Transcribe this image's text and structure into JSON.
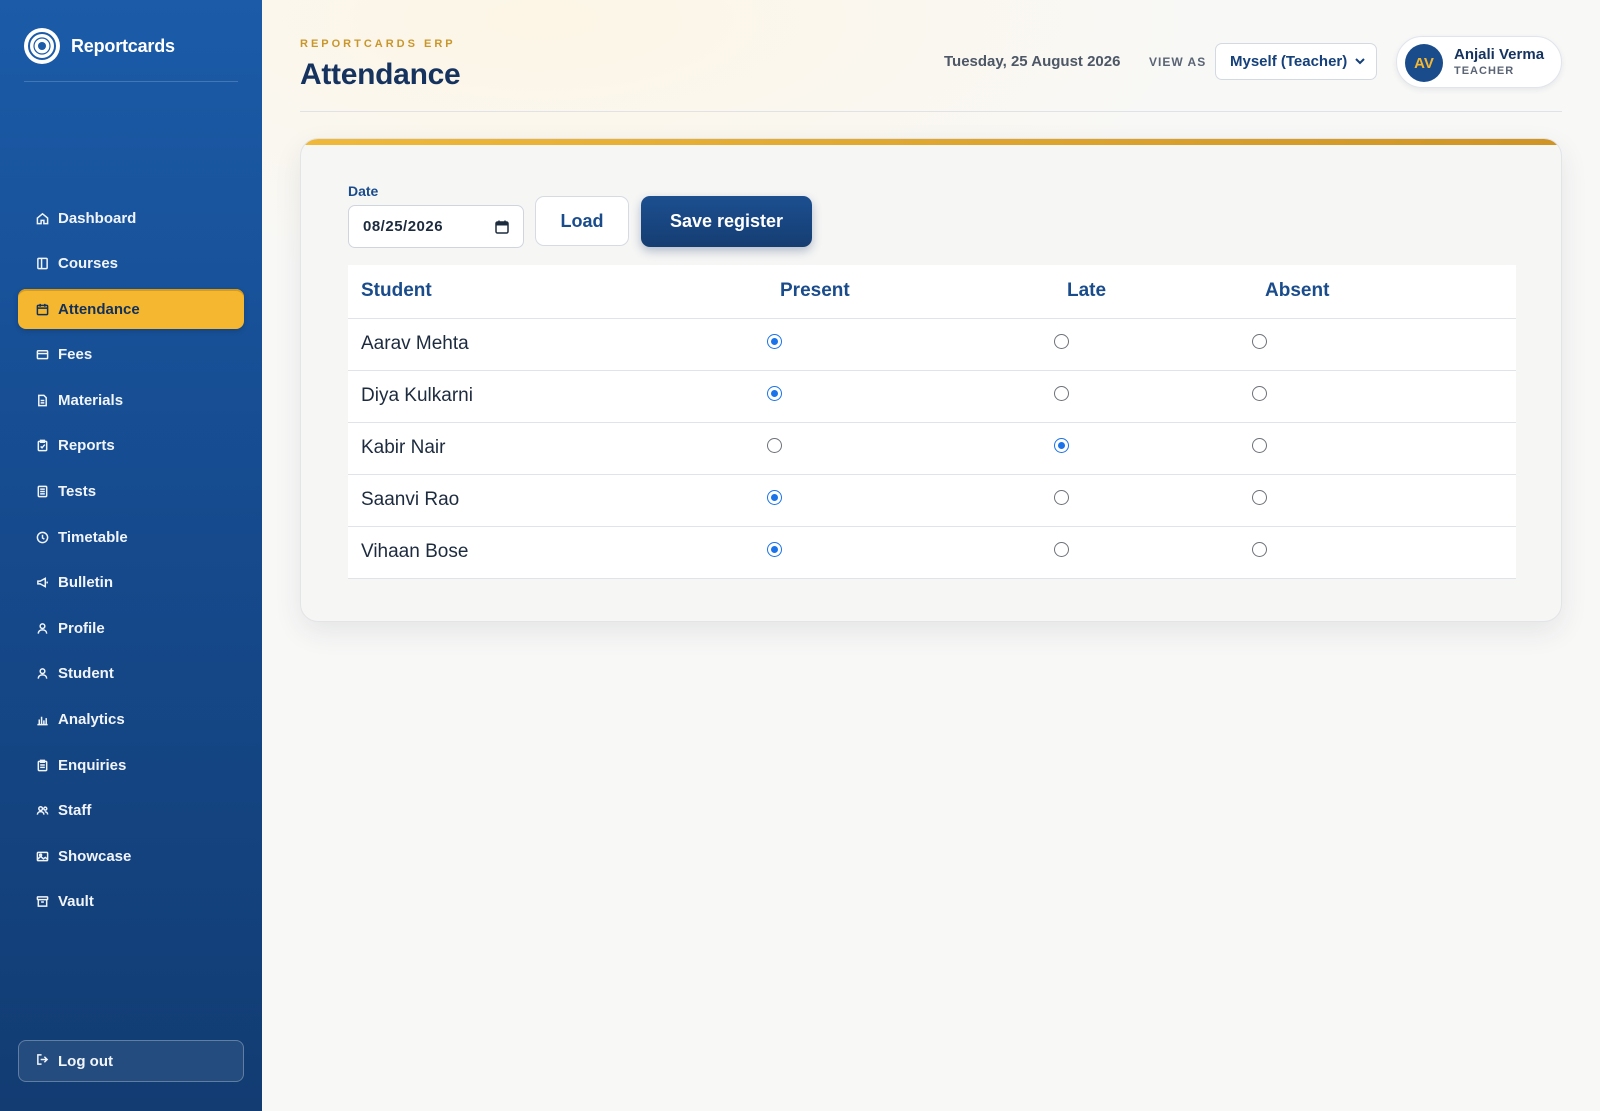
{
  "brand": {
    "name": "Reportcards"
  },
  "sidebar": {
    "items": [
      {
        "label": "Dashboard",
        "icon": "home-icon",
        "active": false
      },
      {
        "label": "Courses",
        "icon": "book-icon",
        "active": false
      },
      {
        "label": "Attendance",
        "icon": "calendar-icon",
        "active": true
      },
      {
        "label": "Fees",
        "icon": "wallet-icon",
        "active": false
      },
      {
        "label": "Materials",
        "icon": "document-icon",
        "active": false
      },
      {
        "label": "Reports",
        "icon": "clipboard-icon",
        "active": false
      },
      {
        "label": "Tests",
        "icon": "test-sheet-icon",
        "active": false
      },
      {
        "label": "Timetable",
        "icon": "clock-icon",
        "active": false
      },
      {
        "label": "Bulletin",
        "icon": "megaphone-icon",
        "active": false
      },
      {
        "label": "Profile",
        "icon": "user-icon",
        "active": false
      },
      {
        "label": "Student",
        "icon": "user-icon",
        "active": false
      },
      {
        "label": "Analytics",
        "icon": "bar-chart-icon",
        "active": false
      },
      {
        "label": "Enquiries",
        "icon": "clipboard-list-icon",
        "active": false
      },
      {
        "label": "Staff",
        "icon": "users-icon",
        "active": false
      },
      {
        "label": "Showcase",
        "icon": "image-icon",
        "active": false
      },
      {
        "label": "Vault",
        "icon": "archive-icon",
        "active": false
      }
    ],
    "logout_label": "Log out"
  },
  "header": {
    "kicker": "REPORTCARDS ERP",
    "title": "Attendance",
    "date": "Tuesday, 25 August 2026",
    "view_as_label": "VIEW AS",
    "view_as_value": "Myself (Teacher)",
    "user": {
      "initials": "AV",
      "name": "Anjali Verma",
      "role": "TEACHER"
    }
  },
  "form": {
    "date_label": "Date",
    "date_value": "08/25/2026",
    "load_label": "Load",
    "save_label": "Save register"
  },
  "table": {
    "columns": [
      "Student",
      "Present",
      "Late",
      "Absent"
    ],
    "rows": [
      {
        "student": "Aarav Mehta",
        "status": "Present"
      },
      {
        "student": "Diya Kulkarni",
        "status": "Present"
      },
      {
        "student": "Kabir Nair",
        "status": "Late"
      },
      {
        "student": "Saanvi Rao",
        "status": "Present"
      },
      {
        "student": "Vihaan Bose",
        "status": "Present"
      }
    ]
  },
  "colors": {
    "sidebar": "#1b5ba8",
    "accent": "#f5b730",
    "primary": "#153d72",
    "radio_selected": "#1a73e8"
  }
}
